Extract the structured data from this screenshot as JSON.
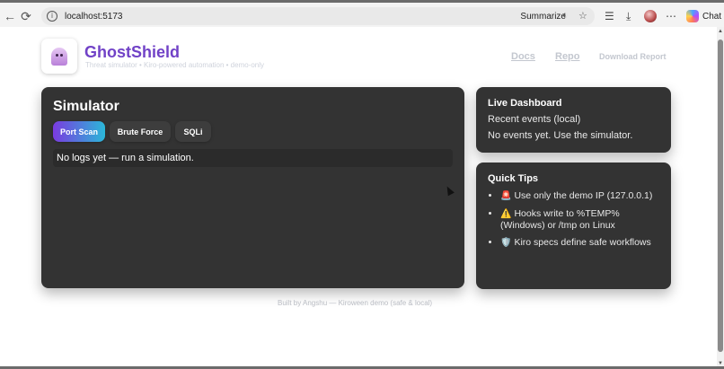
{
  "browser": {
    "url": "localhost:5173",
    "summarize_label": "Summarize",
    "chat_label": "Chat",
    "icons": [
      "back-icon",
      "refresh-icon",
      "info-icon",
      "summarize-icon",
      "favorite-star-icon",
      "collections-icon",
      "downloads-icon",
      "profile-avatar",
      "more-icon",
      "copilot-icon"
    ]
  },
  "header": {
    "brand": "GhostShield",
    "subtitle": "Threat simulator • Kiro-powered automation • demo-only",
    "nav": {
      "docs": "Docs",
      "repo": "Repo",
      "report": "Download Report"
    }
  },
  "simulator": {
    "title": "Simulator",
    "tabs": [
      {
        "label": "Port Scan",
        "active": true
      },
      {
        "label": "Brute Force",
        "active": false
      },
      {
        "label": "SQLi",
        "active": false
      }
    ],
    "log_text": "No logs yet — run a simulation."
  },
  "dashboard": {
    "title": "Live Dashboard",
    "subtitle": "Recent events (local)",
    "empty_text": "No events yet. Use the simulator."
  },
  "tips": {
    "title": "Quick Tips",
    "items": [
      {
        "icon": "🚨",
        "text": "Use only the demo IP (127.0.0.1)"
      },
      {
        "icon": "⚠️",
        "text": "Hooks write to %TEMP% (Windows) or /tmp on Linux"
      },
      {
        "icon": "🛡️",
        "text": "Kiro specs define safe workflows"
      }
    ]
  },
  "footer": {
    "text": "Built by Angshu — Kiroween demo (safe & local)"
  },
  "colors": {
    "accent": "#7142c7",
    "card_bg": "#333333",
    "tab_gradient_start": "#7a3be0",
    "tab_gradient_end": "#2bb7d8"
  }
}
